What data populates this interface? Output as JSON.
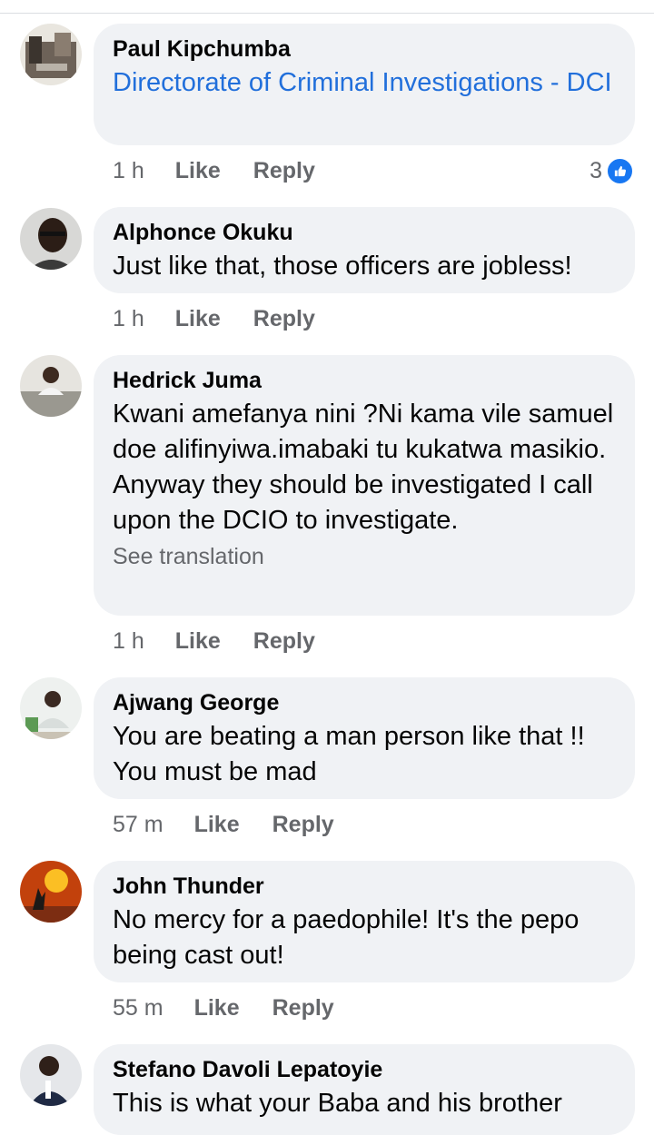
{
  "comments": [
    {
      "author": "Paul Kipchumba",
      "text": "Directorate of Criminal Investigations - DCI",
      "time": "1 h",
      "like": "Like",
      "reply": "Reply",
      "reactions": "3",
      "text_color": "#216fdb"
    },
    {
      "author": "Alphonce Okuku",
      "text": "Just like that, those officers are jobless!",
      "time": "1 h",
      "like": "Like",
      "reply": "Reply"
    },
    {
      "author": "Hedrick Juma",
      "text": "Kwani amefanya nini ?Ni kama vile samuel doe alifinyiwa.imabaki tu kukatwa masikio. Anyway they should be investigated I call upon the DCIO to investigate.",
      "see_translation": "See translation",
      "time": "1 h",
      "like": "Like",
      "reply": "Reply"
    },
    {
      "author": "Ajwang George",
      "text": "You are beating a man person like that !! You must be mad",
      "time": "57 m",
      "like": "Like",
      "reply": "Reply"
    },
    {
      "author": "John Thunder",
      "text": "No mercy for a paedophile! It's the pepo being cast out!",
      "time": "55 m",
      "like": "Like",
      "reply": "Reply"
    },
    {
      "author": "Stefano Davoli Lepatoyie",
      "text": "This is what your Baba and his brother"
    }
  ],
  "colors": {
    "bubble": "#f0f2f5",
    "link": "#216fdb",
    "secondary_text": "#65676b",
    "like_badge": "#1877f2"
  },
  "icons": {
    "reaction": "thumbs-up-icon"
  }
}
